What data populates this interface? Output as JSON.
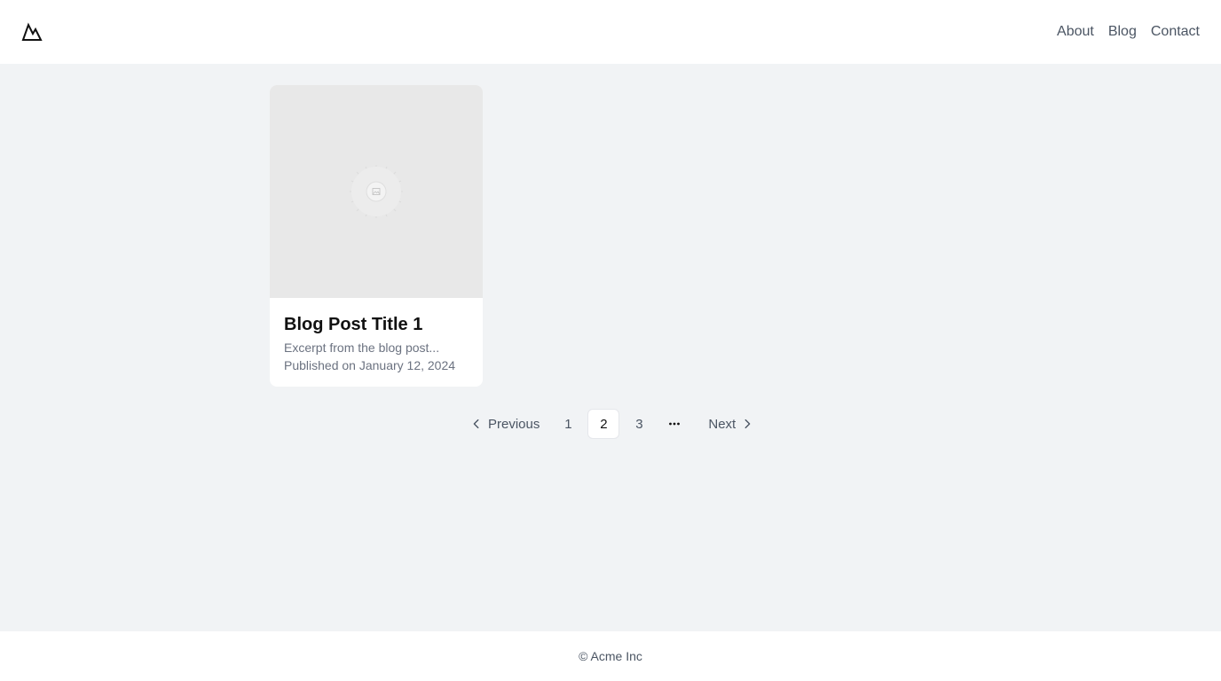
{
  "header": {
    "logo_icon": "mountain-icon",
    "nav": {
      "about": "About",
      "blog": "Blog",
      "contact": "Contact"
    }
  },
  "posts": [
    {
      "image_icon": "image-placeholder-icon",
      "title": "Blog Post Title 1",
      "excerpt": "Excerpt from the blog post...",
      "date": "Published on January 12, 2024"
    }
  ],
  "pagination": {
    "previous_label": "Previous",
    "next_label": "Next",
    "pages": [
      "1",
      "2",
      "3"
    ],
    "current_page": "2",
    "ellipsis": "···"
  },
  "footer": {
    "copyright": "© Acme Inc"
  },
  "colors": {
    "page_background": "#f1f3f5",
    "surface": "#ffffff",
    "muted_text": "#6b7280",
    "image_placeholder": "#e8e8e8"
  }
}
